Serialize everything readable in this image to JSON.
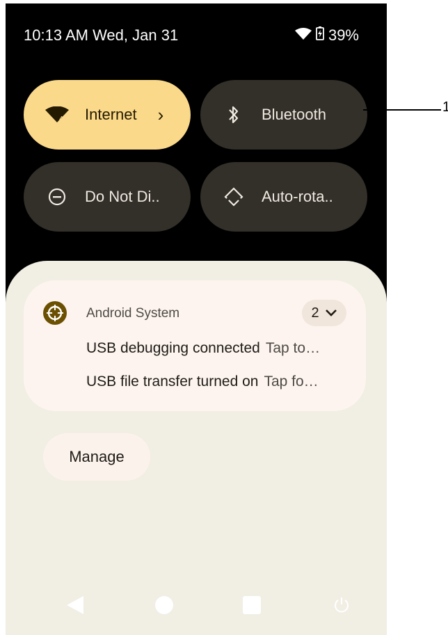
{
  "status_bar": {
    "datetime": "10:13 AM Wed, Jan 31",
    "battery": "39%"
  },
  "quick_settings": {
    "internet": {
      "label": "Internet",
      "state": "on"
    },
    "bluetooth": {
      "label": "Bluetooth",
      "state": "off"
    },
    "do_not_disturb": {
      "label": "Do Not Di..",
      "state": "off"
    },
    "auto_rotate": {
      "label": "Auto-rota..",
      "state": "off"
    }
  },
  "notification": {
    "app_name": "Android System",
    "count": "2",
    "items": [
      {
        "title": "USB debugging connected",
        "text": "Tap to…"
      },
      {
        "title": "USB file transfer turned on",
        "text": "Tap fo…"
      }
    ]
  },
  "manage_label": "Manage",
  "callout": "1",
  "colors": {
    "tile_on": "#fbd98a",
    "tile_off": "#332f29",
    "shade_bg": "#f1eee4",
    "card_bg": "#fdf4ef",
    "app_icon": "#6a5000"
  }
}
